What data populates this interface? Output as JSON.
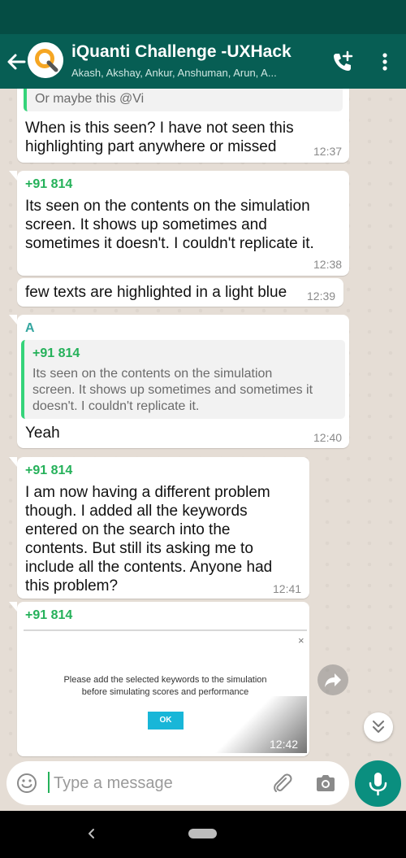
{
  "header": {
    "title": "iQuanti Challenge -UXHack",
    "subtitle": "Akash, Akshay, Ankur, Anshuman, Arun, A..."
  },
  "messages": [
    {
      "quote": {
        "text": "Or maybe this @Vi"
      },
      "text_lines": [
        "When is this seen? I have not seen this",
        "highlighting part anywhere or missed"
      ],
      "time": "12:37"
    },
    {
      "sender": "+91 814",
      "text_lines": [
        "Its seen on the contents on the simulation",
        "screen. It shows up sometimes and",
        "sometimes it doesn't. I couldn't replicate it."
      ],
      "time": "12:38"
    },
    {
      "text_lines": [
        "few texts are highlighted in a light blue"
      ],
      "time": "12:39"
    },
    {
      "sender": "A",
      "quote": {
        "sender": "+91 814",
        "text_lines": [
          "Its seen on the contents on the simulation",
          "screen. It shows up sometimes and sometimes it",
          "doesn't. I couldn't replicate it."
        ]
      },
      "text_lines": [
        "Yeah"
      ],
      "time": "12:40"
    },
    {
      "sender": "+91 814",
      "text_lines": [
        "I am now having a different problem",
        "though. I added all the keywords",
        "entered on the search into the",
        "contents. But still its asking me to",
        "include all the contents. Anyone had",
        "this problem?"
      ],
      "time": "12:41"
    },
    {
      "sender": "+91 814",
      "image": {
        "close_glyph": "×",
        "text_lines": [
          "Please add the selected keywords to the simulation",
          "before simulating scores and performance"
        ],
        "button": "OK"
      },
      "time": "12:42"
    }
  ],
  "composer": {
    "placeholder": "Type a message"
  },
  "colors": {
    "app_bar": "#075e54",
    "status_bar": "#054d44",
    "chat_background": "#e5ddd5",
    "sender_green": "#25b15a",
    "sender_teal": "#35a6a0",
    "mic_button": "#0a8f7f"
  },
  "icons": [
    "back-arrow-icon",
    "group-avatar",
    "add-call-icon",
    "more-vert-icon",
    "forward-icon",
    "double-chevron-down-icon",
    "emoji-icon",
    "attach-icon",
    "camera-icon",
    "mic-icon",
    "nav-back-icon",
    "nav-home-pill"
  ]
}
